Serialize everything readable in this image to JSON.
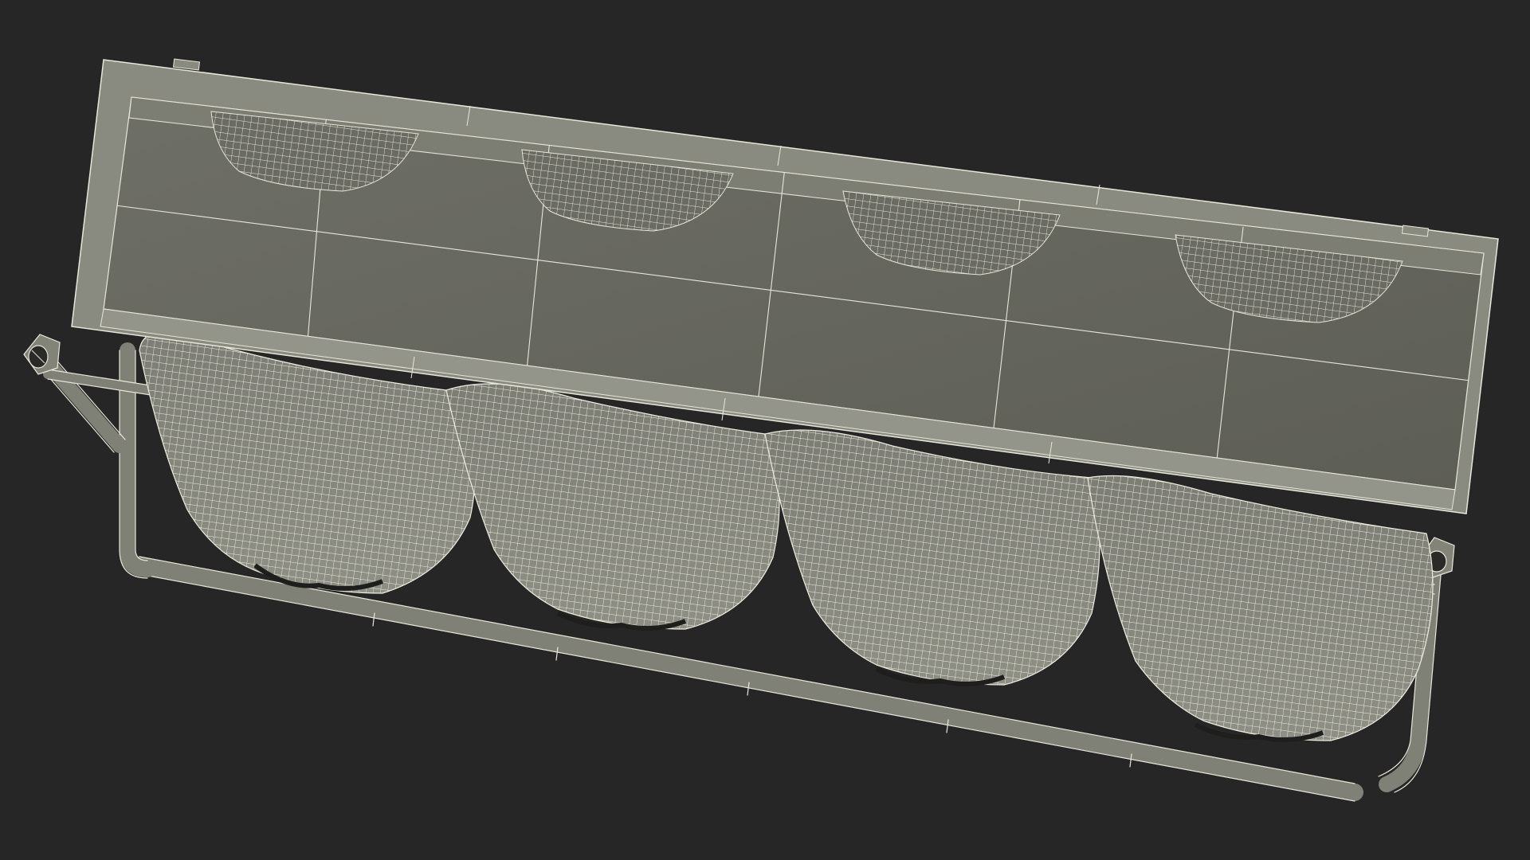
{
  "scene": {
    "subject": "wireframe-3d-model",
    "background_color": "#262626",
    "wire_color": "#e8e6d8",
    "surface_color": "#7a7a70",
    "surface_dark_color": "#5c5c54",
    "bag_color": "#8a8a80",
    "bag_count": 4,
    "has_visible_text": false
  }
}
